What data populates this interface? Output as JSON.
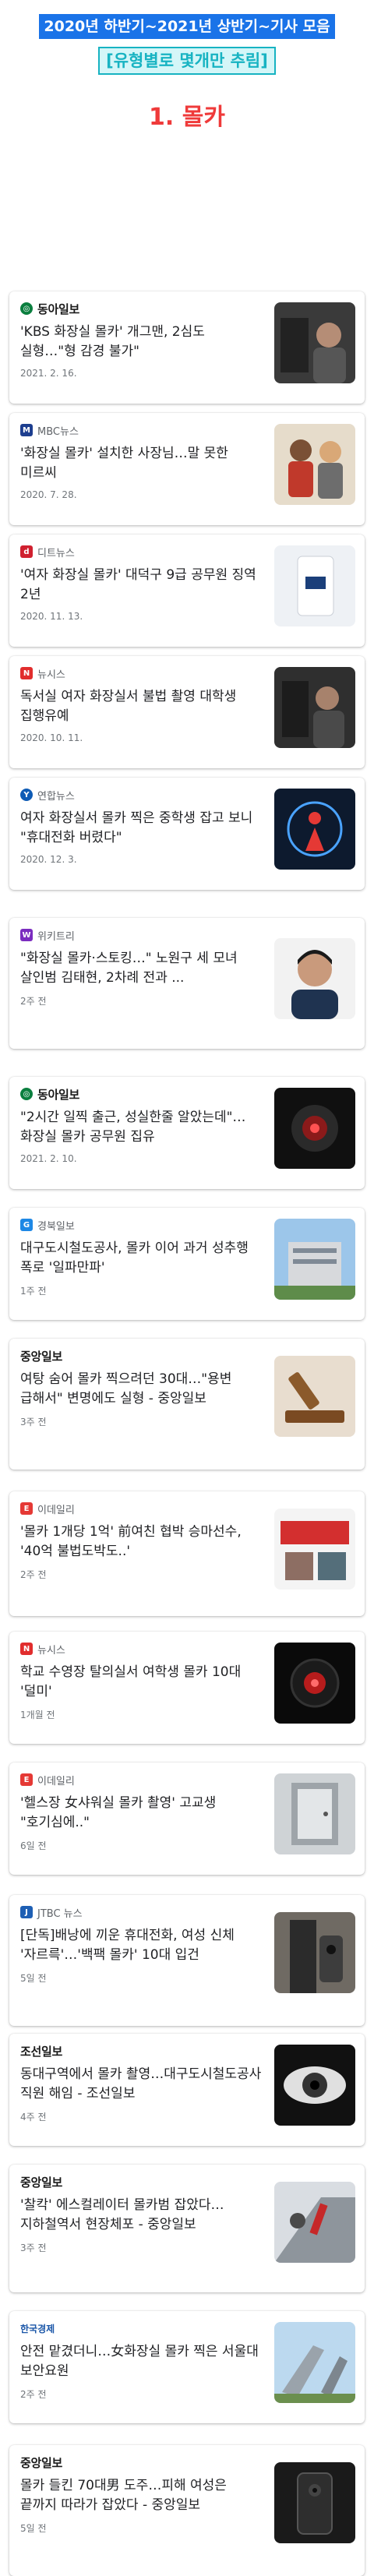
{
  "header": {
    "title_line": "2020년 하반기~2021년 상반기~기사 모음",
    "subtitle_line": "[유형별로 몇개만 추림]",
    "section_title": "1. 몰카"
  },
  "colors": {
    "header_highlight": "#1a73e8",
    "subtitle_highlight": "#17b3c2",
    "section_title": "#ef3a3a"
  },
  "articles": [
    {
      "source": "동아일보",
      "logo_icon": "donga-logo-icon",
      "headline": "'KBS 화장실 몰카' 개그맨, 2심도 실형…\"형 감경 불가\"",
      "date": "2021. 2. 16."
    },
    {
      "source": "MBC뉴스",
      "logo_icon": "mbc-logo-icon",
      "headline": "'화장실 몰카' 설치한 사장님…말 못한 미르씨",
      "date": "2020. 7. 28."
    },
    {
      "source": "디트뉴스",
      "logo_icon": "ditnews-logo-icon",
      "headline": "'여자 화장실 몰카' 대덕구 9급 공무원 징역 2년",
      "date": "2020. 11. 13."
    },
    {
      "source": "뉴시스",
      "logo_icon": "newsis-logo-icon",
      "headline": "독서실 여자 화장실서 불법 촬영 대학생 집행유예",
      "date": "2020. 10. 11."
    },
    {
      "source": "연합뉴스",
      "logo_icon": "yonhap-logo-icon",
      "headline": "여자 화장실서 몰카 찍은 중학생 잡고 보니 \"휴대전화 버렸다\"",
      "date": "2020. 12. 3."
    },
    {
      "source": "위키트리",
      "logo_icon": "wikitree-logo-icon",
      "headline": "\"화장실 몰카·스토킹…\" 노원구 세 모녀 살인범 김태현, 2차례 전과 ...",
      "date": "2주 전"
    },
    {
      "source": "동아일보",
      "logo_icon": "donga-logo-icon",
      "headline": "\"2시간 일찍 출근, 성실한줄 알았는데\"…화장실 몰카 공무원 집유",
      "date": "2021. 2. 10."
    },
    {
      "source": "경북일보",
      "logo_icon": "kyongbuk-logo-icon",
      "headline": "대구도시철도공사, 몰카 이어 과거 성추행 폭로 '일파만파'",
      "date": "1주 전"
    },
    {
      "source": "중앙일보",
      "logo_icon": "joongang-logo-icon",
      "headline": "여탕 숨어 몰카 찍으려던 30대…\"용변 급해서\" 변명에도 실형 - 중앙일보",
      "date": "3주 전"
    },
    {
      "source": "이데일리",
      "logo_icon": "edaily-logo-icon",
      "headline": "'몰카 1개당 1억' 前여친 협박 승마선수, '40억 불법도박도..'",
      "date": "2주 전"
    },
    {
      "source": "뉴시스",
      "logo_icon": "newsis-logo-icon",
      "headline": "학교 수영장 탈의실서 여학생 몰카 10대 '덜미'",
      "date": "1개월 전"
    },
    {
      "source": "이데일리",
      "logo_icon": "edaily-logo-icon",
      "headline": "'헬스장 女샤워실 몰카 촬영' 고교생 \"호기심에..\"",
      "date": "6일 전"
    },
    {
      "source": "JTBC 뉴스",
      "logo_icon": "jtbc-logo-icon",
      "headline": "[단독]배낭에 끼운 휴대전화, 여성 신체 '자르륵'…'백팩 몰카' 10대 입건",
      "date": "5일 전"
    },
    {
      "source": "조선일보",
      "logo_icon": "chosun-logo-icon",
      "headline": "동대구역에서 몰카 촬영…대구도시철도공사 직원 해임 - 조선일보",
      "date": "4주 전"
    },
    {
      "source": "중앙일보",
      "logo_icon": "joongang-logo-icon",
      "headline": "'찰칵' 에스컬레이터 몰카범 잡았다…지하철역서 현장체포 - 중앙일보",
      "date": "3주 전"
    },
    {
      "source": "한국경제",
      "logo_icon": "hankyung-logo-icon",
      "headline": "안전 맡겼더니…女화장실 몰카 찍은 서울대 보안요원",
      "date": "2주 전"
    },
    {
      "source": "중앙일보",
      "logo_icon": "joongang-logo-icon",
      "headline": "몰카 들킨 70대男 도주…피해 여성은 끝까지 따라가 잡았다 - 중앙일보",
      "date": "5일 전"
    }
  ]
}
